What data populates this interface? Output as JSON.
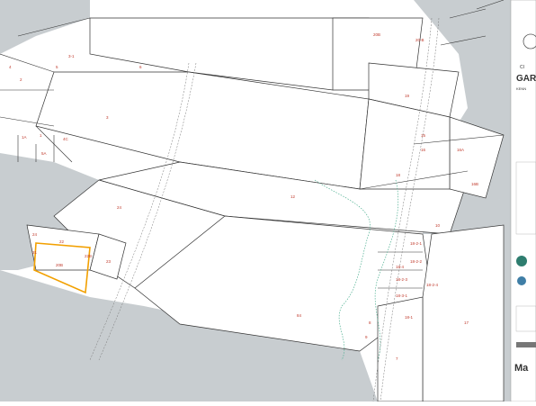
{
  "map": {
    "parcel_labels": {
      "p6": "6",
      "p3": "3",
      "p12": "12",
      "p24": "24",
      "p84": "84",
      "p20b": "20B",
      "p20b2": "20-B",
      "p3_1": "3-1",
      "p4c": "4C",
      "p19": "19",
      "p15": "15",
      "p16": "16",
      "p16a": "16A",
      "p16b": "16B",
      "p18": "18",
      "p10": "10",
      "p17": "17",
      "p7": "7",
      "p8": "8",
      "p22": "22",
      "p23": "23",
      "p21": "21",
      "p22b": "22B",
      "p20b3": "20B",
      "p18_2_1": "18-2-1",
      "p18_2_2": "18-2-2",
      "p18_2_3": "18-2-3",
      "p18_2_4": "18-2-4",
      "p18_3_1": "18-3-1",
      "p18_4": "18-4",
      "p18_1": "18-1",
      "p9": "9",
      "p5": "5",
      "p1": "1",
      "p2": "2",
      "p4": "4",
      "p5a": "5A",
      "p1a": "1A",
      "p24b": "24"
    },
    "title_block": {
      "line1": "CI",
      "line2": "GAR",
      "line3": "KENN",
      "footer": "Ma"
    },
    "colors": {
      "road": "#c8cdd0",
      "line": "#333333",
      "highlight": "#f2a000",
      "label": "#c0392b",
      "creek": "#4caf90"
    }
  }
}
